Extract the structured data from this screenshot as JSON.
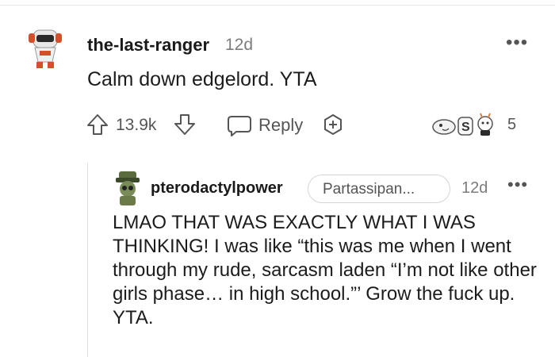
{
  "comment1": {
    "username": "the-last-ranger",
    "age": "12d",
    "more": "•••",
    "body": "Calm down edgelord. YTA",
    "score": "13.9k",
    "reply_label": "Reply",
    "award_count": "5",
    "icons": [
      "upvote-icon",
      "downvote-icon",
      "reply-icon",
      "add-award-icon",
      "awards-icon",
      "more-icon"
    ]
  },
  "comment2": {
    "username": "pterodactylpower",
    "flair": "Partassipan...",
    "age": "12d",
    "more": "•••",
    "body": "LMAO THAT WAS EXACTLY WHAT I WAS THINKING! I was like “this was me when I went through my rude, sarcasm laden “I’m not like other girls phase… in high school.”’ Grow the fuck up. YTA."
  },
  "colors": {
    "text": "#1c1c1c",
    "meta": "#7c7c7c",
    "icon": "#555555",
    "divider": "#e0e0e0"
  }
}
